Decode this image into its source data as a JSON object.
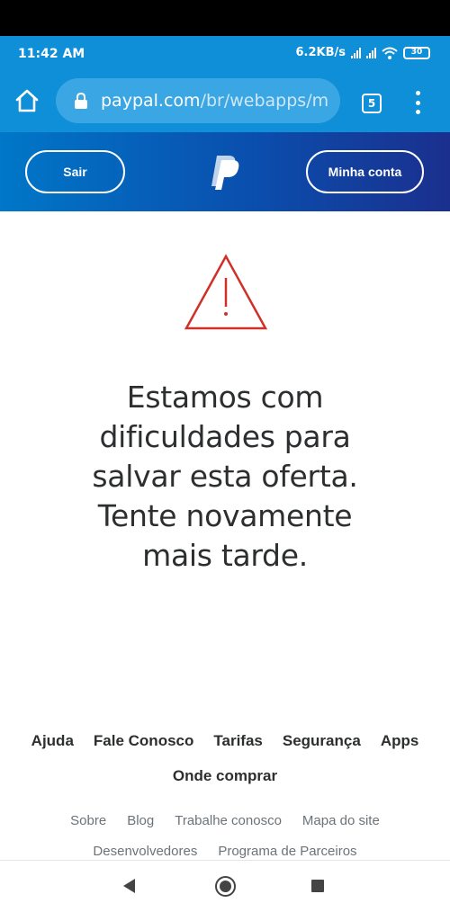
{
  "status_bar": {
    "time": "11:42 AM",
    "network_speed": "6.2KB/s",
    "battery": "30"
  },
  "browser": {
    "url_host": "paypal.com",
    "url_path": "/br/webapps/m",
    "tab_count": "5",
    "icons": [
      "home-icon",
      "lock-icon",
      "tabs-icon",
      "menu-icon"
    ]
  },
  "header": {
    "logout_label": "Sair",
    "account_label": "Minha conta",
    "logo": "paypal-logo",
    "colors": {
      "gradient_start": "#0077c8",
      "gradient_end": "#1b2f8e"
    }
  },
  "main": {
    "warning_icon": "warning-triangle-icon",
    "warning_color": "#d03027",
    "message_lines": [
      "Estamos com",
      "dificuldades para",
      "salvar esta oferta.",
      "Tente novamente",
      "mais tarde."
    ]
  },
  "footer": {
    "primary_links": [
      "Ajuda",
      "Fale Conosco",
      "Tarifas",
      "Segurança",
      "Apps",
      "Onde comprar"
    ],
    "secondary_links": [
      "Sobre",
      "Blog",
      "Trabalhe conosco",
      "Mapa do site",
      "Desenvolvedores",
      "Programa de Parceiros"
    ]
  },
  "system_nav": {
    "icons": [
      "back-icon",
      "home-circle-icon",
      "recents-icon"
    ]
  }
}
